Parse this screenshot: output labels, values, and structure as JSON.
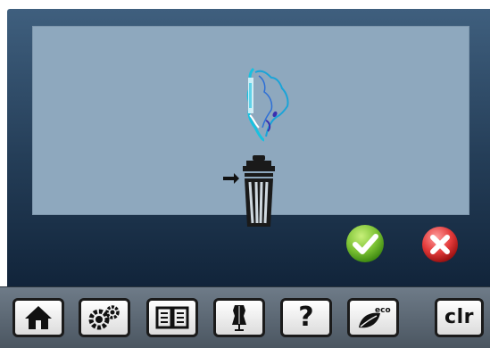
{
  "dialog": {
    "title": "",
    "motif_icon": "embroidery-motif-icon",
    "arrow_icon": "arrow-right-icon",
    "delete_icon": "trash-can-icon"
  },
  "actions": {
    "confirm_icon": "checkmark-icon",
    "cancel_icon": "close-x-icon"
  },
  "toolbar": {
    "items": [
      {
        "icon": "home-icon"
      },
      {
        "icon": "settings-gears-icon"
      },
      {
        "icon": "tutorial-book-icon"
      },
      {
        "icon": "dress-form-icon"
      },
      {
        "icon": "help-icon",
        "label": "?"
      },
      {
        "icon": "eco-leaf-icon",
        "label": "eco"
      },
      {
        "icon": "clear-icon",
        "label": "clr"
      }
    ]
  },
  "colors": {
    "display_top": "#3f5f7e",
    "display_bottom": "#11243a",
    "panel": "#8ea8be",
    "confirm": "#7cc234",
    "cancel": "#e33a3a",
    "motif": "#19c1e0"
  }
}
